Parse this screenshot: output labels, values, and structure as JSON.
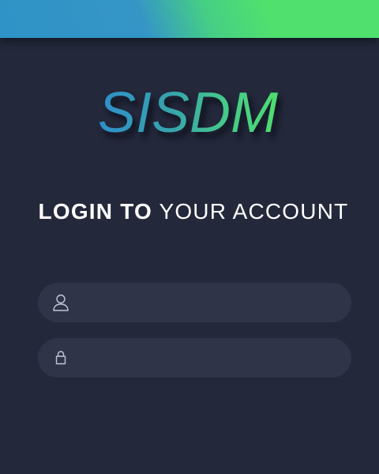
{
  "app": {
    "logo_text": "SISDM"
  },
  "heading": {
    "bold": "LOGIN TO",
    "light": "YOUR ACCOUNT"
  },
  "form": {
    "username": {
      "value": "",
      "placeholder": "",
      "icon": "user-icon"
    },
    "password": {
      "value": "",
      "placeholder": "",
      "icon": "lock-icon"
    }
  },
  "colors": {
    "background": "#23283b",
    "field_background": "#2f3448",
    "accent_blue": "#2f93c7",
    "accent_green": "#4fe06e",
    "text": "#ffffff"
  }
}
